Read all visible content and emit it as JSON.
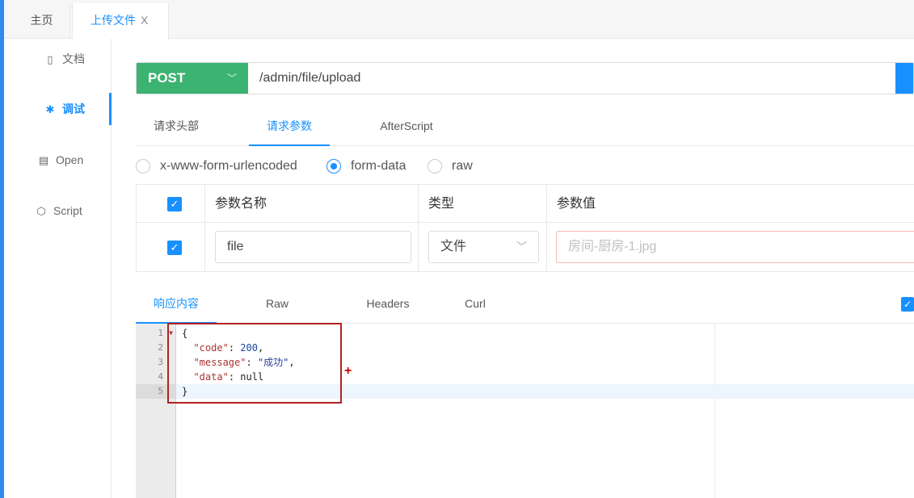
{
  "tabs": [
    {
      "label": "主页"
    },
    {
      "label": "上传文件",
      "close": "X"
    }
  ],
  "sidebar": {
    "items": [
      {
        "label": "文档",
        "icon": "document-icon"
      },
      {
        "label": "调试",
        "icon": "bug-icon"
      },
      {
        "label": "Open",
        "icon": "file-icon"
      },
      {
        "label": "Script",
        "icon": "code-icon"
      }
    ]
  },
  "request": {
    "method": "POST",
    "url": "/admin/file/upload"
  },
  "request_tabs": [
    "请求头部",
    "请求参数",
    "AfterScript"
  ],
  "body_types": [
    "x-www-form-urlencoded",
    "form-data",
    "raw"
  ],
  "selected_body_type": "form-data",
  "params_table": {
    "headers": [
      "参数名称",
      "类型",
      "参数值"
    ],
    "rows": [
      {
        "name": "file",
        "type": "文件",
        "value_placeholder": "房间-厨房-1.jpg",
        "checked": true
      }
    ]
  },
  "response_tabs": [
    "响应内容",
    "Raw",
    "Headers",
    "Curl"
  ],
  "response": {
    "line_numbers": [
      "1",
      "2",
      "3",
      "4",
      "5"
    ],
    "lines": {
      "l1": "{",
      "code_key": "\"code\"",
      "code_val": "200",
      "message_key": "\"message\"",
      "message_val": "\"成功\"",
      "data_key": "\"data\"",
      "data_val": "null",
      "l5": "}"
    }
  },
  "colors": {
    "accent": "#1890ff",
    "method": "#3cb371",
    "highlight_box": "#b22222"
  }
}
